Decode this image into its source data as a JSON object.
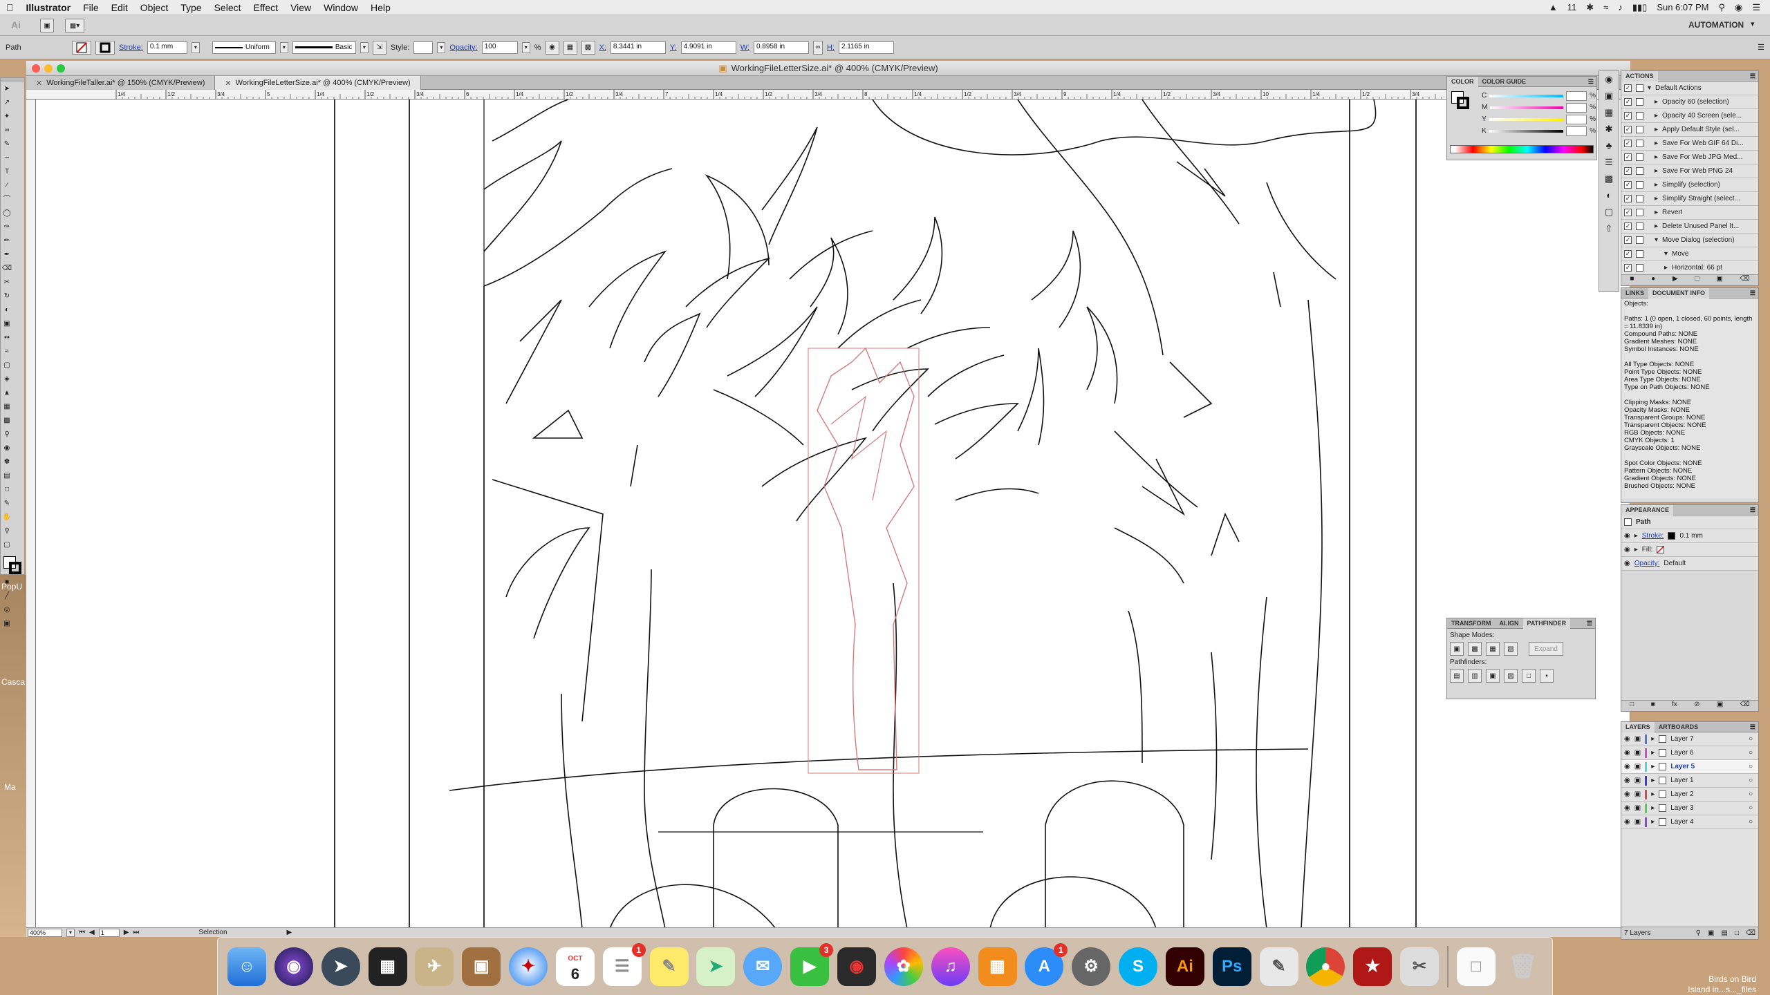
{
  "menubar": {
    "app_name": "Illustrator",
    "menus": [
      "File",
      "Edit",
      "Object",
      "Type",
      "Select",
      "Effect",
      "View",
      "Window",
      "Help"
    ],
    "status_count": "11",
    "clock": "Sun 6:07 PM"
  },
  "appbar": {
    "workspace": "AUTOMATION"
  },
  "control": {
    "object_type": "Path",
    "stroke_label": "Stroke:",
    "stroke_value": "0.1 mm",
    "profile": "Uniform",
    "brush": "Basic",
    "style_label": "Style:",
    "opacity_label": "Opacity:",
    "opacity_value": "100",
    "opacity_unit": "%",
    "x_label": "X:",
    "x_value": "8.3441 in",
    "y_label": "Y:",
    "y_value": "4.9091 in",
    "w_label": "W:",
    "w_value": "0.8958 in",
    "h_label": "H:",
    "h_value": "2.1165 in"
  },
  "document": {
    "title": "WorkingFileLetterSize.ai* @ 400% (CMYK/Preview)",
    "tabs": [
      {
        "label": "WorkingFileTaller.ai* @ 150% (CMYK/Preview)"
      },
      {
        "label": "WorkingFileLetterSize.ai* @ 400% (CMYK/Preview)"
      }
    ],
    "ruler_labels": [
      "1/4",
      "1/2",
      "3/4",
      "5",
      "1/4",
      "1/2",
      "3/4",
      "6",
      "1/4",
      "1/2",
      "3/4",
      "7",
      "1/4",
      "1/2",
      "3/4",
      "8",
      "1/4",
      "1/2",
      "3/4",
      "9",
      "1/4",
      "1/2",
      "3/4",
      "10",
      "1/4",
      "1/2",
      "3/4",
      "11",
      "1/4"
    ],
    "zoom": "400%",
    "artboard_num": "1",
    "status_tool": "Selection"
  },
  "color_panel": {
    "tabs": [
      "COLOR",
      "COLOR GUIDE"
    ],
    "channels": [
      "C",
      "M",
      "Y",
      "K"
    ],
    "unit": "%"
  },
  "actions_panel": {
    "title": "ACTIONS",
    "items": [
      "Default Actions",
      "Opacity 60 (selection)",
      "Opacity 40 Screen (sele...",
      "Apply Default Style (sel...",
      "Save For Web GIF 64 Di...",
      "Save For Web JPG Med...",
      "Save For Web PNG 24",
      "Simplify (selection)",
      "Simplify Straight (select...",
      "Revert",
      "Delete Unused Panel It...",
      "Move Dialog (selection)",
      "Move",
      "Horizontal: 66 pt"
    ]
  },
  "document_info": {
    "tabs": [
      "LINKS",
      "DOCUMENT INFO"
    ],
    "lines": [
      "Objects:",
      "",
      "Paths: 1 (0 open, 1 closed, 60 points, length",
      "= 11.8339 in)",
      "Compound Paths: NONE",
      "Gradient Meshes: NONE",
      "Symbol Instances: NONE",
      "",
      "All Type Objects: NONE",
      "Point Type Objects: NONE",
      "Area Type Objects: NONE",
      "Type on Path Objects: NONE",
      "",
      "Clipping Masks: NONE",
      "Opacity Masks: NONE",
      "Transparent Groups: NONE",
      "Transparent Objects: NONE",
      "RGB Objects: NONE",
      "CMYK Objects: 1",
      "Grayscale Objects: NONE",
      "",
      "Spot Color Objects: NONE",
      "Pattern Objects: NONE",
      "Gradient Objects: NONE",
      "Brushed Objects: NONE"
    ]
  },
  "appearance": {
    "title": "APPEARANCE",
    "object": "Path",
    "stroke_label": "Stroke:",
    "stroke_value": "0.1 mm",
    "fill_label": "Fill:",
    "opacity_label": "Opacity:",
    "opacity_value": "Default"
  },
  "pathfinder": {
    "tabs": [
      "TRANSFORM",
      "ALIGN",
      "PATHFINDER"
    ],
    "shape_modes": "Shape Modes:",
    "expand": "Expand",
    "pathfinders": "Pathfinders:"
  },
  "layers": {
    "tabs": [
      "LAYERS",
      "ARTBOARDS"
    ],
    "items": [
      "Layer 7",
      "Layer 6",
      "Layer 5",
      "Layer 1",
      "Layer 2",
      "Layer 3",
      "Layer 4"
    ],
    "selected_index": 2,
    "count": "7 Layers",
    "colors": [
      "#4a7bd8",
      "#d84ad0",
      "#4ad8d8",
      "#3a3ad8",
      "#d84a4a",
      "#4ad84a",
      "#8a4ad8"
    ]
  },
  "left_desktop": {
    "label1": "PopU",
    "label2": "Casca",
    "label3": "Ma"
  },
  "dock": {
    "calendar_month": "OCT",
    "calendar_day": "6",
    "badges": {
      "reminders": "1",
      "facetime": "3",
      "appstore": "1"
    },
    "ai_label": "Ai",
    "ps_label": "Ps"
  },
  "desktop_file": {
    "line1": "Birds on Bird",
    "line2": "Island in...s..._files"
  },
  "colors": {
    "selection": "#d47b7b",
    "accent": "#1f3fb5"
  }
}
